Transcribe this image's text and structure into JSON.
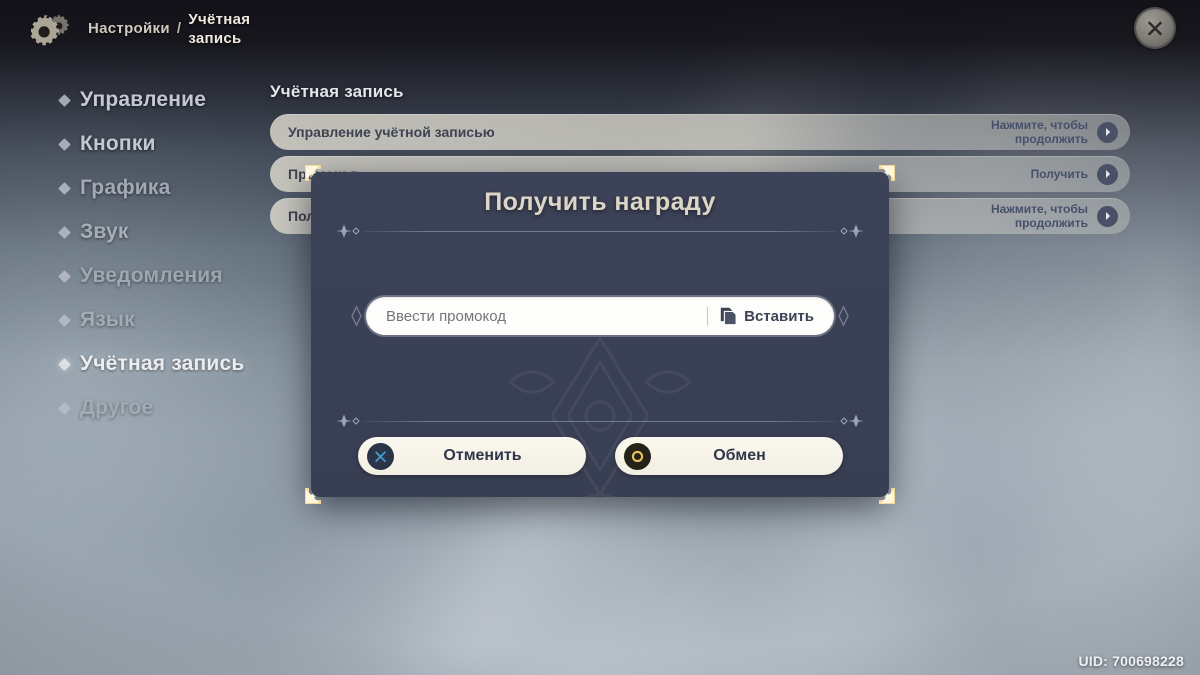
{
  "header": {
    "gear_icon": "gear-icon",
    "breadcrumb_root": "Настройки",
    "breadcrumb_separator": "/",
    "breadcrumb_leaf": "Учётная запись",
    "close_icon": "close-icon"
  },
  "sidebar": {
    "items": [
      {
        "label": "Управление"
      },
      {
        "label": "Кнопки"
      },
      {
        "label": "Графика"
      },
      {
        "label": "Звук"
      },
      {
        "label": "Уведомления"
      },
      {
        "label": "Язык"
      },
      {
        "label": "Учётная запись"
      },
      {
        "label": "Другое"
      }
    ]
  },
  "content": {
    "title": "Учётная запись",
    "rows": [
      {
        "label": "Управление учётной записью",
        "hint": "Нажмите, чтобы продолжить",
        "arrow_icon": "chevron-right-icon"
      },
      {
        "label": "Промокод",
        "hint": "Получить",
        "arrow_icon": "chevron-right-icon"
      },
      {
        "label": "Получить награду",
        "hint": "Нажмите, чтобы продолжить",
        "arrow_icon": "chevron-right-icon"
      }
    ]
  },
  "modal": {
    "title": "Получить награду",
    "input_placeholder": "Ввести промокод",
    "input_value": "",
    "paste_label": "Вставить",
    "paste_icon": "clipboard-icon",
    "cancel_label": "Отменить",
    "cancel_icon": "circle-x-icon",
    "confirm_label": "Обмен",
    "confirm_icon": "circle-o-icon"
  },
  "footer": {
    "uid": "UID: 700698228"
  },
  "colors": {
    "modal_bg": "#3a4055",
    "title_gold": "#ddd6c6",
    "corner_gold": "#f4dca6",
    "button_cream": "#f6f2e6",
    "cancel_blue": "#3fa3d8",
    "confirm_gold": "#e8c55c",
    "row_cream": "#e2ded2",
    "sidebar_text": "#c3c8d2"
  }
}
